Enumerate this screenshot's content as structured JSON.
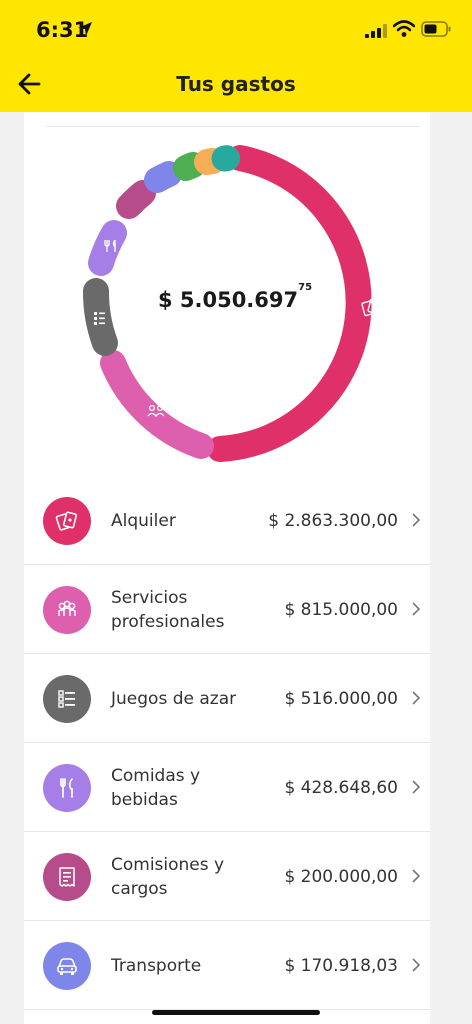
{
  "status_bar": {
    "time": "6:31"
  },
  "header": {
    "title": "Tus gastos"
  },
  "summary": {
    "total_main": "$ 5.050.697",
    "total_cents": "75"
  },
  "colors": {
    "header": "#ffe600",
    "alquiler": "#e0306a",
    "servicios": "#dd5fae",
    "juegos": "#6a6a6a",
    "comidas": "#a57ee8",
    "comisiones": "#b64c8a",
    "transporte": "#7f86ea",
    "green": "#4caf50",
    "orange": "#f6ad55",
    "teal": "#28a99e"
  },
  "categories": [
    {
      "name": "Alquiler",
      "amount": "$ 2.863.300,00",
      "value": 2863300.0,
      "icon": "rent-cards-icon",
      "color": "#e0306a"
    },
    {
      "name": "Servicios profesionales",
      "amount": "$ 815.000,00",
      "value": 815000.0,
      "icon": "professionals-icon",
      "color": "#dd5fae"
    },
    {
      "name": "Juegos de azar",
      "amount": "$ 516.000,00",
      "value": 516000.0,
      "icon": "checklist-icon",
      "color": "#6a6a6a"
    },
    {
      "name": "Comidas y bebidas",
      "amount": "$ 428.648,60",
      "value": 428648.6,
      "icon": "fork-knife-icon",
      "color": "#a57ee8"
    },
    {
      "name": "Comisiones y cargos",
      "amount": "$ 200.000,00",
      "value": 200000.0,
      "icon": "receipt-icon",
      "color": "#b64c8a"
    },
    {
      "name": "Transporte",
      "amount": "$ 170.918,03",
      "value": 170918.03,
      "icon": "car-icon",
      "color": "#7f86ea"
    }
  ]
}
